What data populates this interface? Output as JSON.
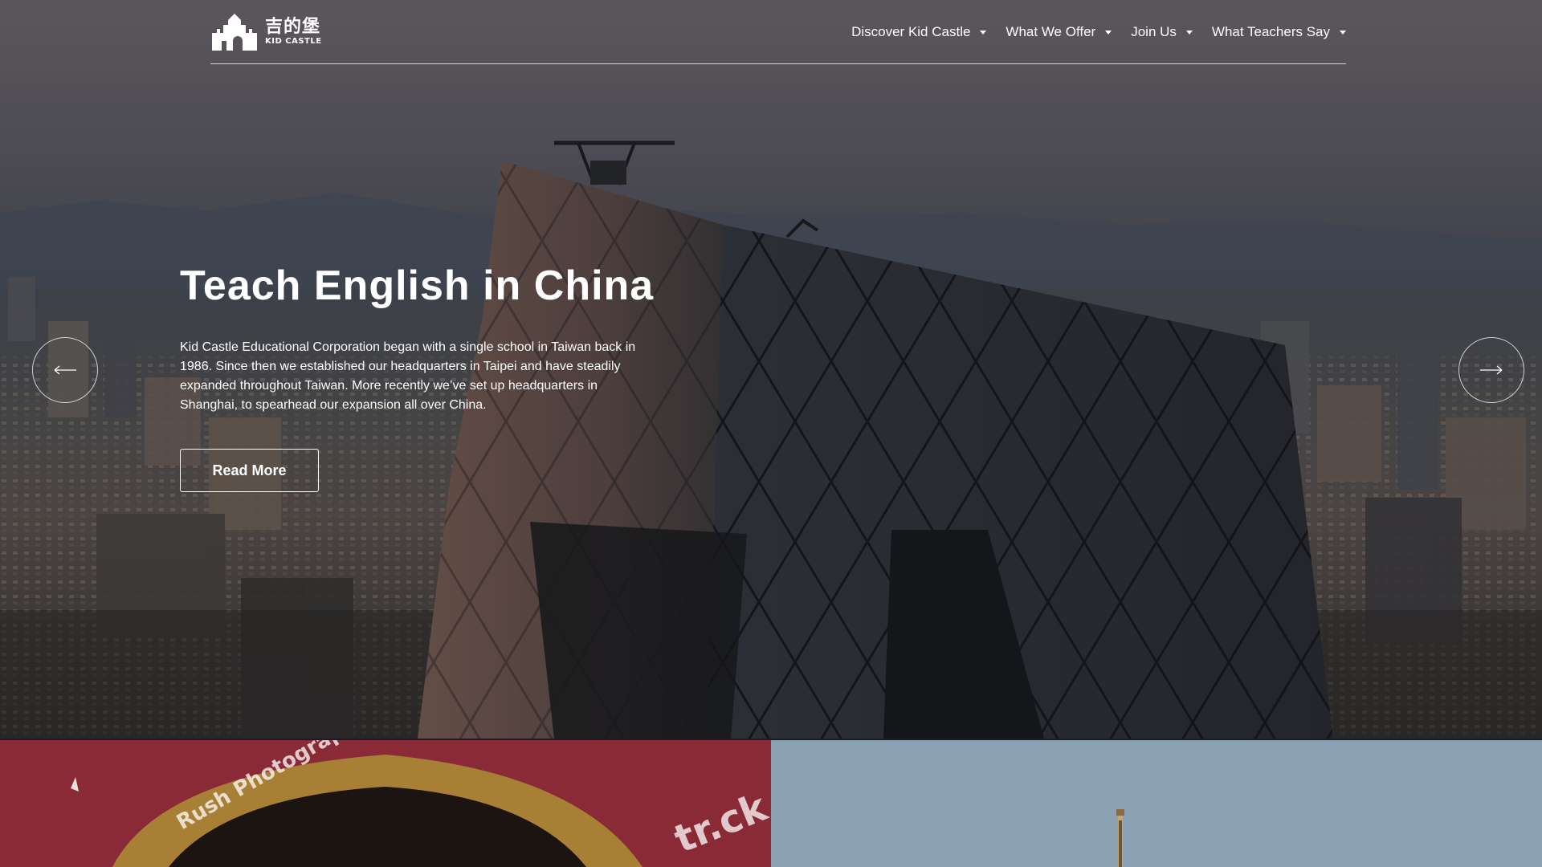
{
  "brand": {
    "logo_cn": "吉的堡",
    "logo_en": "KID CASTLE"
  },
  "nav": {
    "items": [
      {
        "label": "Discover Kid Castle"
      },
      {
        "label": "What We Offer"
      },
      {
        "label": "Join Us"
      },
      {
        "label": "What Teachers Say"
      }
    ]
  },
  "hero": {
    "title": "Teach English in China",
    "body": "Kid Castle Educational Corporation began with a single school in Taiwan back in 1986. Since then we established our headquarters in Taipei and have steadily expanded throughout Taiwan. More recently we’ve set up headquarters in Shanghai, to spearhead our expansion all over China.",
    "cta_label": "Read More",
    "prev_icon": "arrow-left-icon",
    "next_icon": "arrow-right-icon"
  },
  "cards": {
    "left_watermark": "Rush Photograph",
    "left_watermark_2": "tr.ck"
  },
  "colors": {
    "accent": "#ffffff",
    "card_left_bg": "#8a2a36",
    "card_right_sky": "#7d98ae"
  }
}
